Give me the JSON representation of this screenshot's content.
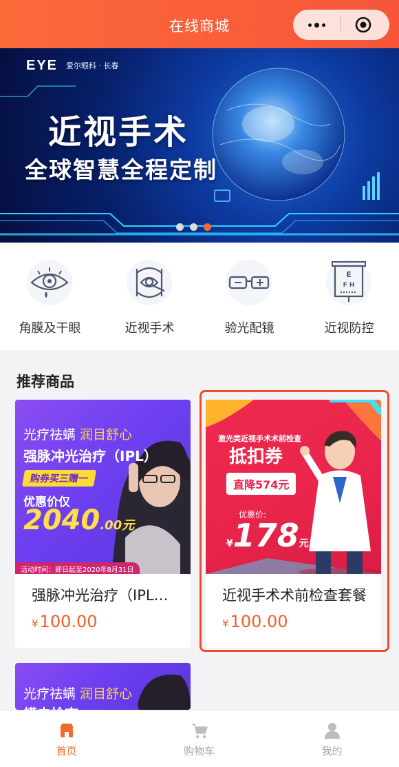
{
  "header": {
    "title": "在线商城"
  },
  "banner": {
    "logo": "EYE",
    "logo_sub": "爱尔眼科 · 长春",
    "headline": "近视手术",
    "subheadline": "全球智慧全程定制",
    "indicator_count": 3,
    "active_index": 2
  },
  "categories": [
    {
      "label": "角膜及干眼",
      "icon": "eye-icon"
    },
    {
      "label": "近视手术",
      "icon": "surgery-eye-icon"
    },
    {
      "label": "验光配镜",
      "icon": "glasses-icon"
    },
    {
      "label": "近视防控",
      "icon": "eye-chart-icon"
    }
  ],
  "recommended": {
    "title": "推荐商品",
    "products": [
      {
        "name": "强脉冲光治疗（IPL…",
        "currency": "¥",
        "price": "100.00",
        "poster": {
          "line1_a": "光疗祛螨 ",
          "line1_b": "润目舒心",
          "line2": "强脉冲光治疗（IPL）",
          "tag": "购券买三赠一",
          "line3": "优惠价仅",
          "big": "2040",
          "big_dec": ".00元",
          "footer": "活动时间：即日起至2020年8月31日"
        }
      },
      {
        "name": "近视手术术前检查套餐",
        "currency": "¥",
        "price": "100.00",
        "poster": {
          "line1": "激光类近视手术术前检查",
          "line2": "抵扣券",
          "pill": "直降574元",
          "line3": "优惠价:",
          "currency": "¥",
          "big": "178",
          "unit": "元"
        }
      }
    ],
    "partial_card": {
      "line1_a": "光疗祛螨 ",
      "line1_b": "润目舒心",
      "line2": "螨虫检查"
    }
  },
  "tabbar": [
    {
      "label": "首页",
      "icon": "home-icon",
      "active": true
    },
    {
      "label": "购物车",
      "icon": "cart-icon",
      "active": false
    },
    {
      "label": "我的",
      "icon": "user-icon",
      "active": false
    }
  ],
  "colors": {
    "accent": "#f36b2c",
    "price": "#f25d2c",
    "highlight_border": "#f24a2a"
  }
}
